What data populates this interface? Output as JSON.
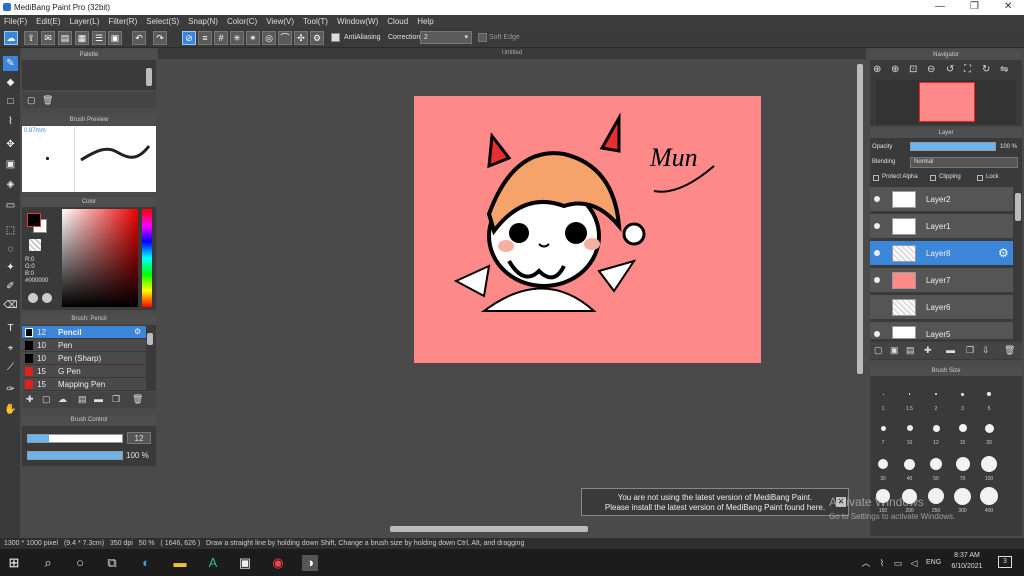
{
  "window": {
    "title": "MediBang Paint Pro (32bit)",
    "min": "—",
    "max": "❐",
    "close": "✕"
  },
  "menu": [
    "File(F)",
    "Edit(E)",
    "Layer(L)",
    "Filter(R)",
    "Select(S)",
    "Snap(N)",
    "Color(C)",
    "View(V)",
    "Tool(T)",
    "Window(W)",
    "Cloud",
    "Help"
  ],
  "toolbar": {
    "antialiasing": "AntiAliasing",
    "correction_label": "Correction",
    "correction_value": "2",
    "soft_edge": "Soft Edge"
  },
  "panels": {
    "palette": "Palette",
    "brush_preview": "Brush Preview",
    "brush_preview_size": "0.87mm",
    "color": "Color",
    "brush": "Brush: Pencil",
    "brush_control": "Brush Control",
    "navigator": "Navigator",
    "layer": "Layer",
    "brush_size": "Brush Size",
    "canvas_tab": "Untitled"
  },
  "color": {
    "r": "R:0",
    "g": "G:0",
    "b": "B:0",
    "hex": "#000000",
    "fg": "#000000",
    "bg": "#ffffff"
  },
  "brushes": [
    {
      "size": "12",
      "name": "Pencil",
      "color": "#000000",
      "selected": true
    },
    {
      "size": "10",
      "name": "Pen",
      "color": "#000000"
    },
    {
      "size": "10",
      "name": "Pen (Sharp)",
      "color": "#000000"
    },
    {
      "size": "15",
      "name": "G Pen",
      "color": "#e0201c"
    },
    {
      "size": "15",
      "name": "Mapping Pen",
      "color": "#e0201c"
    }
  ],
  "brush_control": {
    "size": "12",
    "size_fraction": 0.22,
    "opacity": "100 %",
    "opacity_fraction": 1.0
  },
  "layer_panel": {
    "opacity_label": "Opacity",
    "opacity_value": "100 %",
    "blending_label": "Blending",
    "blending_value": "Normal",
    "protect_alpha": "Protect Alpha",
    "clipping": "Clipping",
    "lock": "Lock"
  },
  "layers": [
    {
      "name": "Layer2",
      "selected": false
    },
    {
      "name": "Layer1",
      "selected": false
    },
    {
      "name": "Layer8",
      "selected": true
    },
    {
      "name": "Layer7",
      "selected": false
    },
    {
      "name": "Layer6",
      "selected": false
    },
    {
      "name": "Layer5",
      "selected": false
    }
  ],
  "brush_sizes": [
    [
      "1",
      "1.5",
      "2",
      "3",
      "5"
    ],
    [
      "7",
      "10",
      "12",
      "15",
      "20"
    ],
    [
      "30",
      "40",
      "50",
      "70",
      "100"
    ],
    [
      "150",
      "200",
      "250",
      "300",
      "400"
    ]
  ],
  "canvas_text": "Mun",
  "canvas_color": "#fd8a88",
  "notification": {
    "line1": "You are not using the latest version of MediBang Paint.",
    "line2": "Please install the latest version of MediBang Paint found here.",
    "close": "✕"
  },
  "watermark": {
    "line1": "Activate Windows",
    "line2": "Go to Settings to activate Windows."
  },
  "status": {
    "dimensions": "1300 * 1000 pixel",
    "physical": "(9.4 * 7.3cm)",
    "dpi": "350 dpi",
    "zoom": "50 %",
    "coords": "( 1646, 626 )",
    "hint": "Draw a straight line by holding down Shift, Change a brush size by holding down Ctrl, Alt, and dragging"
  },
  "taskbar": {
    "time": "8:37 AM",
    "date": "6/10/2021",
    "lang": "ENG",
    "notif": "3"
  }
}
